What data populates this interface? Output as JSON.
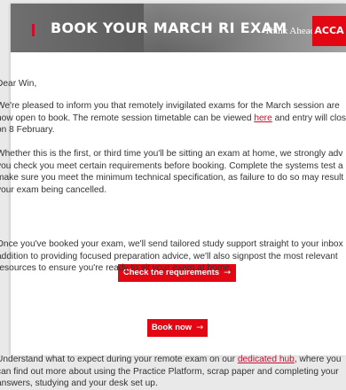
{
  "banner": {
    "title": "BOOK YOUR MARCH RI EXAM",
    "tagline": "Think Ahead",
    "logo_text": "ACCA",
    "accent_color": "#c8102e",
    "logo_color": "#e30613"
  },
  "greeting": "Dear Win,",
  "paragraph1": {
    "line1": "We're pleased to inform you that remotely invigilated exams for the March session are",
    "line2_before": "now open to book. The remote session timetable can be viewed ",
    "line2_link": "here",
    "line2_after": " and entry will clos",
    "line3": "on 8 February."
  },
  "paragraph2": {
    "line1": "Whether this is the first, or third time you'll be sitting an exam at home, we strongly adv",
    "line2": "you check you meet certain requirements before booking. Complete the systems test a",
    "line3": "make sure you meet the minimum technical specification, as failure to do so may result",
    "line4": "your exam being cancelled."
  },
  "cta_requirements": {
    "label": "Check the requirements",
    "icon": "arrow-right-icon"
  },
  "paragraph3": {
    "line1": "Once you've booked your exam, we'll send tailored study support straight to your inbox",
    "line2": "addition to providing focused preparation advice, we'll also signpost the most relevant",
    "line3": "resources to ensure you're ready to sit your exam at home."
  },
  "cta_book": {
    "label": "Book now",
    "icon": "arrow-right-icon"
  },
  "paragraph4": {
    "line1_before": "Understand what to expect during your remote exam on our ",
    "line1_link": "dedicated hub",
    "line1_after": ", where you",
    "line2": "can find out more about using the Practice Platform, scrap paper and completing your",
    "line3": "answers, studying and your desk set up."
  }
}
